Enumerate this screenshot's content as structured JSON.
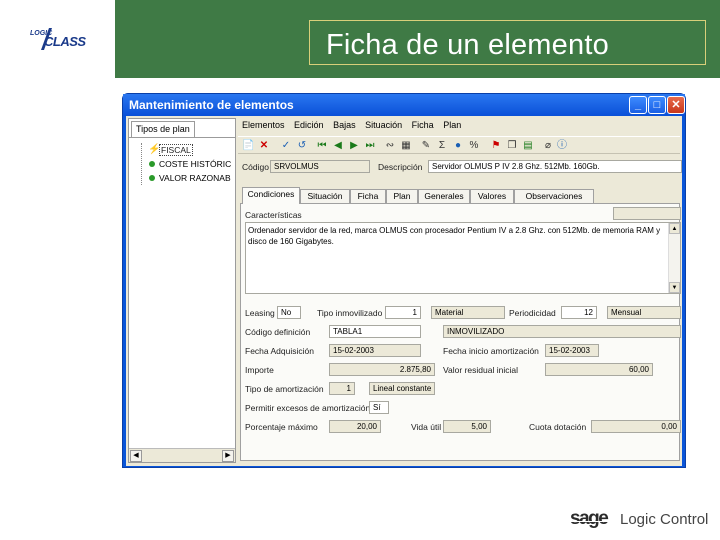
{
  "slide": {
    "title": "Ficha de un elemento",
    "logo_small": "LOGIC",
    "logo_big": "CLASS",
    "footer_brand": "sage",
    "footer_product": "Logic Control"
  },
  "window": {
    "title": "Mantenimiento de elementos",
    "btn_min": "_",
    "btn_max": "□",
    "btn_close": "✕"
  },
  "left_pane": {
    "tab": "Tipos de plan",
    "items": [
      {
        "label": "FISCAL",
        "selected": true,
        "icon": "bolt-icon"
      },
      {
        "label": "COSTE HISTÓRIC",
        "selected": false,
        "icon": "green-dot-icon"
      },
      {
        "label": "VALOR RAZONAB",
        "selected": false,
        "icon": "green-dot-icon"
      }
    ]
  },
  "menu": [
    "Elementos",
    "Edición",
    "Bajas",
    "Situación",
    "Ficha",
    "Plan"
  ],
  "toolbar_icons": [
    "new-icon",
    "delete-icon",
    "check-icon",
    "undo-icon",
    "first-icon",
    "prev-icon",
    "next-icon",
    "last-icon",
    "link-icon",
    "table-icon",
    "edit-icon",
    "sum-icon",
    "drop-icon",
    "percent-icon",
    "filter-icon",
    "copy-icon",
    "excel-icon",
    "attach-icon",
    "info-icon"
  ],
  "header": {
    "codigo_label": "Código",
    "codigo_value": "SRVOLMUS",
    "descripcion_label": "Descripción",
    "descripcion_value": "Servidor OLMUS P IV 2.8 Ghz. 512Mb. 160Gb."
  },
  "tabs": [
    "Condiciones",
    "Situación",
    "Ficha",
    "Plan",
    "Generales",
    "Valores",
    "Observaciones"
  ],
  "form": {
    "caracteristicas_label": "Características",
    "caracteristicas_text": "Ordenador servidor de la red, marca OLMUS con procesador Pentium IV a 2.8 Ghz. con 512Mb. de memoria RAM y disco de 160 Gigabytes.",
    "leasing_label": "Leasing",
    "leasing_value": "No",
    "tipo_inmov_label": "Tipo inmovilizado",
    "tipo_inmov_value": "1",
    "tipo_inmov_desc": "Material",
    "periodicidad_label": "Periodicidad",
    "periodicidad_value": "12",
    "periodicidad_desc": "Mensual",
    "codigo_def_label": "Código definición",
    "codigo_def_value": "TABLA1",
    "codigo_def_desc": "INMOVILIZADO",
    "fecha_adq_label": "Fecha Adquisición",
    "fecha_adq_value": "15-02-2003",
    "fecha_inicio_label": "Fecha inicio amortización",
    "fecha_inicio_value": "15-02-2003",
    "importe_label": "Importe",
    "importe_value": "2.875,80",
    "valor_residual_label": "Valor residual inicial",
    "valor_residual_value": "60,00",
    "tipo_amort_label": "Tipo de amortización",
    "tipo_amort_value": "1",
    "tipo_amort_desc": "Lineal constante",
    "permitir_label": "Permitir excesos de amortización",
    "permitir_value": "Sí",
    "porcentaje_label": "Porcentaje máximo",
    "porcentaje_value": "20,00",
    "vida_util_label": "Vida útil",
    "vida_util_value": "5,00",
    "cuota_label": "Cuota dotación",
    "cuota_value": "0,00"
  }
}
